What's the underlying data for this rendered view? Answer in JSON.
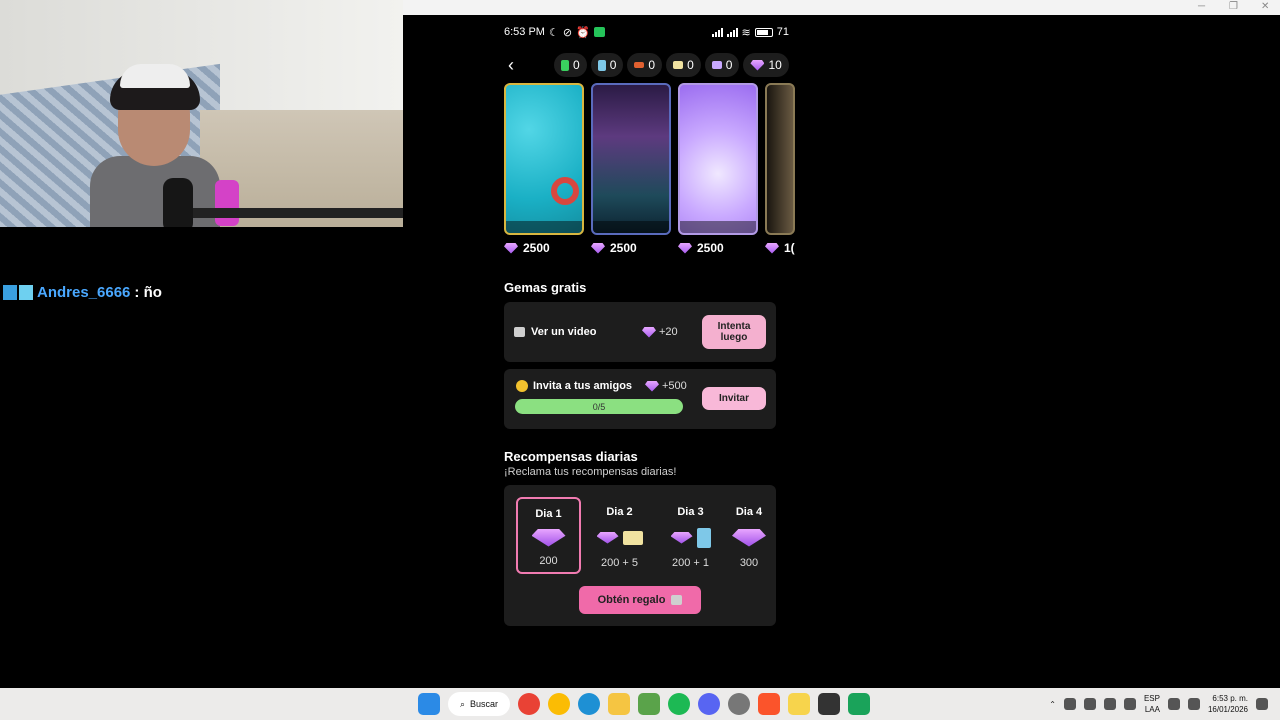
{
  "chat": {
    "username": "Andres_6666",
    "message": ": ño"
  },
  "status_bar": {
    "time": "6:53 PM",
    "battery": "71"
  },
  "currencies": [
    {
      "icon": "green-token-icon",
      "value": "0",
      "color": "#3ad05f"
    },
    {
      "icon": "blue-card-icon",
      "value": "0",
      "color": "#7ec8e8"
    },
    {
      "icon": "glasses-icon",
      "value": "0",
      "color": "#e06030"
    },
    {
      "icon": "ticket-icon",
      "value": "0",
      "color": "#f0e2a0"
    },
    {
      "icon": "megaphone-icon",
      "value": "0",
      "color": "#c8a8ff"
    },
    {
      "icon": "gem-icon",
      "value": "10",
      "color": "#c57cff"
    }
  ],
  "themes": [
    {
      "price": "2500"
    },
    {
      "price": "2500"
    },
    {
      "price": "2500"
    },
    {
      "price": "1("
    }
  ],
  "free_gems": {
    "title": "Gemas gratis",
    "video": {
      "label": "Ver un video",
      "reward": "+20",
      "button": "Intenta luego"
    },
    "invite": {
      "label": "Invita a tus amigos",
      "reward": "+500",
      "progress_text": "0/5",
      "progress": 0.0,
      "button": "Invitar"
    }
  },
  "daily": {
    "title": "Recompensas diarias",
    "subtitle": "¡Reclama tus recompensas diarias!",
    "days": [
      {
        "name": "Dia 1",
        "amount": "200"
      },
      {
        "name": "Dia 2",
        "amount": "200 + 5"
      },
      {
        "name": "Dia 3",
        "amount": "200 + 1"
      },
      {
        "name": "Dia 4",
        "amount": "300"
      }
    ],
    "claim_button": "Obtén regalo"
  },
  "taskbar": {
    "search_label": "Buscar",
    "lang_top": "ESP",
    "lang_bottom": "LAA",
    "time": "6:53 p. m.",
    "date": "16/01/2026"
  }
}
